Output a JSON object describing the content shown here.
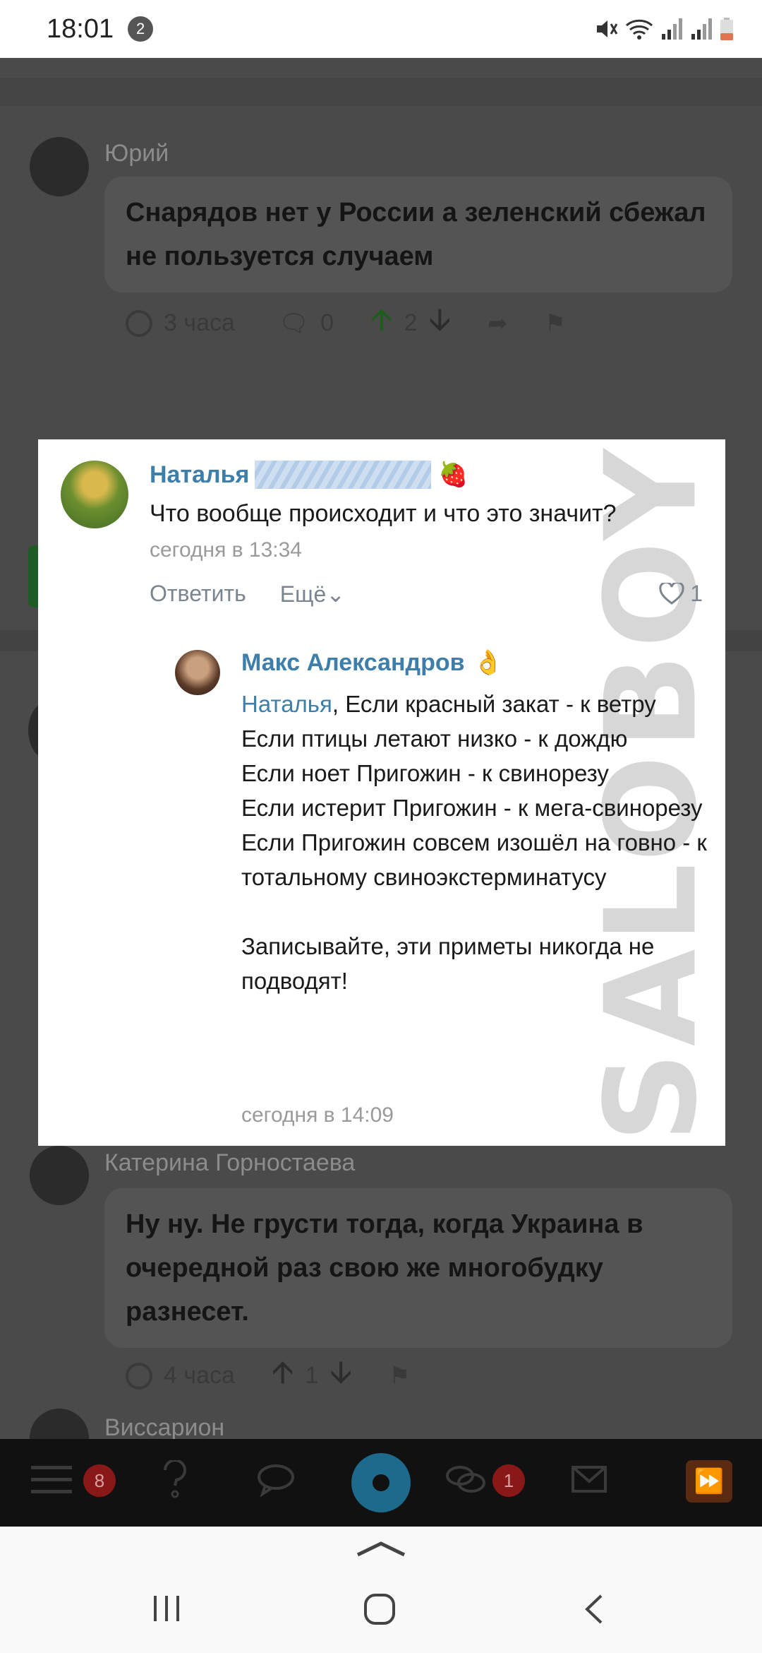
{
  "status_bar": {
    "time": "18:01",
    "notification_count": "2",
    "icons": [
      "mute-icon",
      "wifi-icon",
      "signal-icon",
      "signal-icon",
      "battery-icon"
    ]
  },
  "feed": {
    "comments": [
      {
        "author": "Юрий",
        "text": "Снарядов нет у России а зеленский сбежал не пользуется случаем",
        "time": "3 часа",
        "replies": "0",
        "score": "2"
      },
      {
        "author": "Катерина Горностаева",
        "text": "Ну ну. Не грусти тогда, когда Украина в очередной раз свою же многобудку разнесет.",
        "time": "4 часа",
        "score": "1"
      },
      {
        "author": "Виссарион"
      }
    ]
  },
  "overlay": {
    "watermark": "SALOBOY",
    "comment": {
      "author": "Наталья",
      "text": "Что вообще происходит и что это значит?",
      "time": "сегодня в 13:34",
      "reply_label": "Ответить",
      "more_label": "Ещё",
      "likes": "1"
    },
    "reply": {
      "author": "Макс Александров",
      "mention": "Наталья",
      "lines": [
        ", Если красный закат - к ветру",
        "Если птицы летают низко - к дождю",
        "Если ноет Пригожин - к свинорезу",
        "Если истерит Пригожин - к мега-свинорезу",
        "Если Пригожин совсем изошёл на говно - к тотальному свиноэкстерминатусу",
        "",
        "Записывайте, эти приметы никогда не подводят!"
      ],
      "time": "сегодня в 14:09"
    }
  },
  "app_bar": {
    "menu_badge": "8",
    "messages_badge": "1"
  },
  "colors": {
    "link": "#3d7eaa",
    "accent": "#1d6a8c",
    "badge": "#8a1818"
  }
}
